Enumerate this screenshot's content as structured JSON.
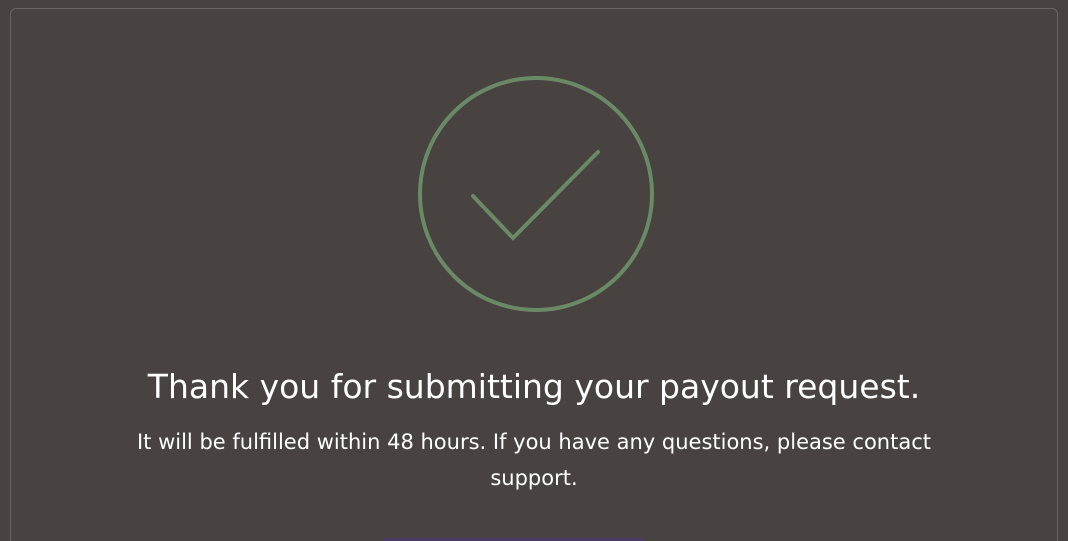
{
  "confirmation": {
    "title": "Thank you for submitting your payout request.",
    "message": "It will be fulfilled within 48 hours. If you have any questions, please contact support.",
    "icon": "check-circle-icon",
    "icon_color": "#6a8a66"
  },
  "colors": {
    "background": "#484341",
    "panel_border": "#6a6563",
    "text": "#ffffff"
  }
}
